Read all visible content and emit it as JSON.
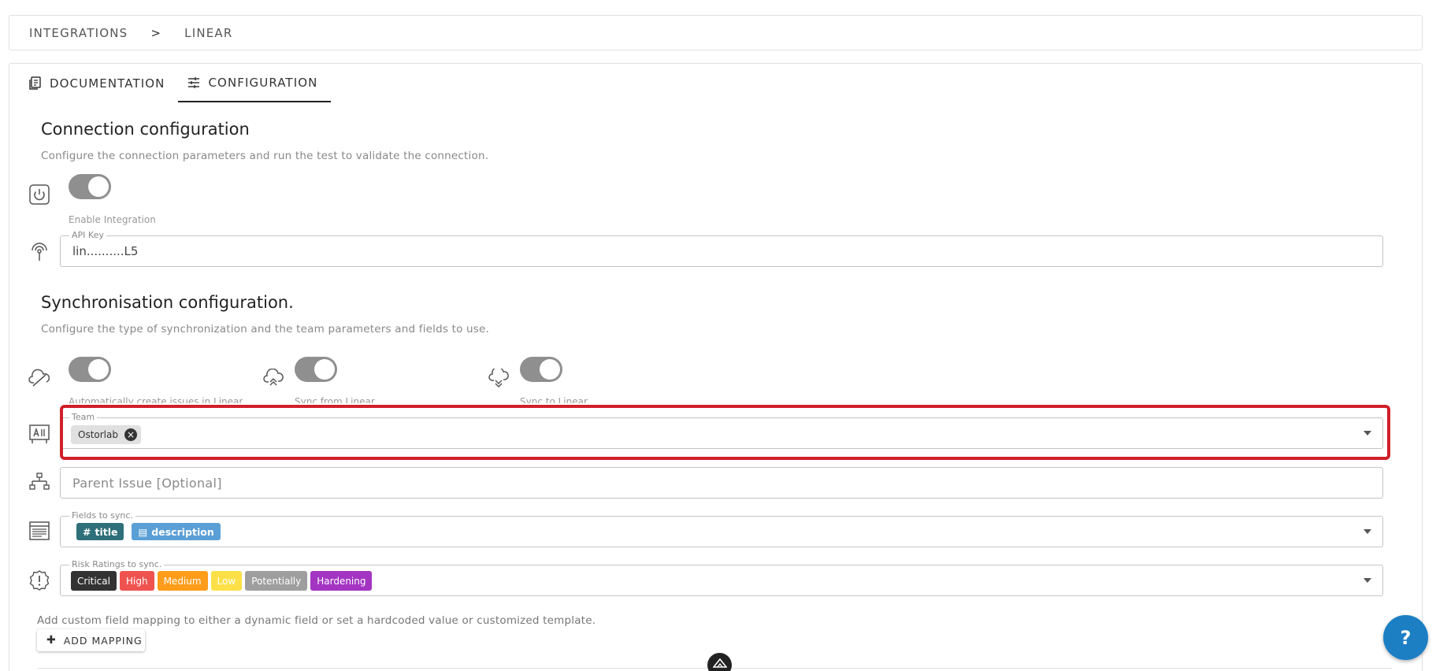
{
  "breadcrumb": {
    "root": "INTEGRATIONS",
    "separator": ">",
    "current": "LINEAR"
  },
  "tabs": [
    {
      "label": "DOCUMENTATION",
      "icon": "document-icon",
      "active": false
    },
    {
      "label": "CONFIGURATION",
      "icon": "tune-icon",
      "active": true
    }
  ],
  "connection": {
    "title": "Connection configuration",
    "description": "Configure the connection parameters and run the test to validate the connection.",
    "enable_label": "Enable Integration",
    "enable_on": true,
    "api_key_legend": "API Key",
    "api_key_value": "lin..........L5"
  },
  "sync": {
    "title": "Synchronisation configuration.",
    "description": "Configure the type of synchronization and the team parameters and fields to use.",
    "toggles": [
      {
        "label": "Automatically create issues in Linear",
        "on": true
      },
      {
        "label": "Sync from Linear",
        "on": true
      },
      {
        "label": "Sync to Linear",
        "on": true
      }
    ],
    "team_legend": "Team",
    "team_chips": [
      "Ostorlab"
    ],
    "parent_issue_placeholder": "Parent Issue [Optional]",
    "fields_legend": "Fields to sync.",
    "fields_chips": [
      {
        "label": "title",
        "symbol": "#",
        "color": "#2e6f7a"
      },
      {
        "label": "description",
        "symbol": "▤",
        "color": "#5a9fd6"
      }
    ],
    "risk_legend": "Risk Ratings to sync.",
    "risk_chips": [
      {
        "label": "Critical",
        "color": "#333333"
      },
      {
        "label": "High",
        "color": "#ef5350"
      },
      {
        "label": "Medium",
        "color": "#ff9d1a"
      },
      {
        "label": "Low",
        "color": "#fde047"
      },
      {
        "label": "Potentially",
        "color": "#9e9e9e"
      },
      {
        "label": "Hardening",
        "color": "#a335c2"
      }
    ]
  },
  "custom_mapping": {
    "description": "Add custom field mapping to either a dynamic field or set a hardcoded value or customized template.",
    "button_label": "ADD MAPPING"
  },
  "help": {
    "label": "?"
  }
}
